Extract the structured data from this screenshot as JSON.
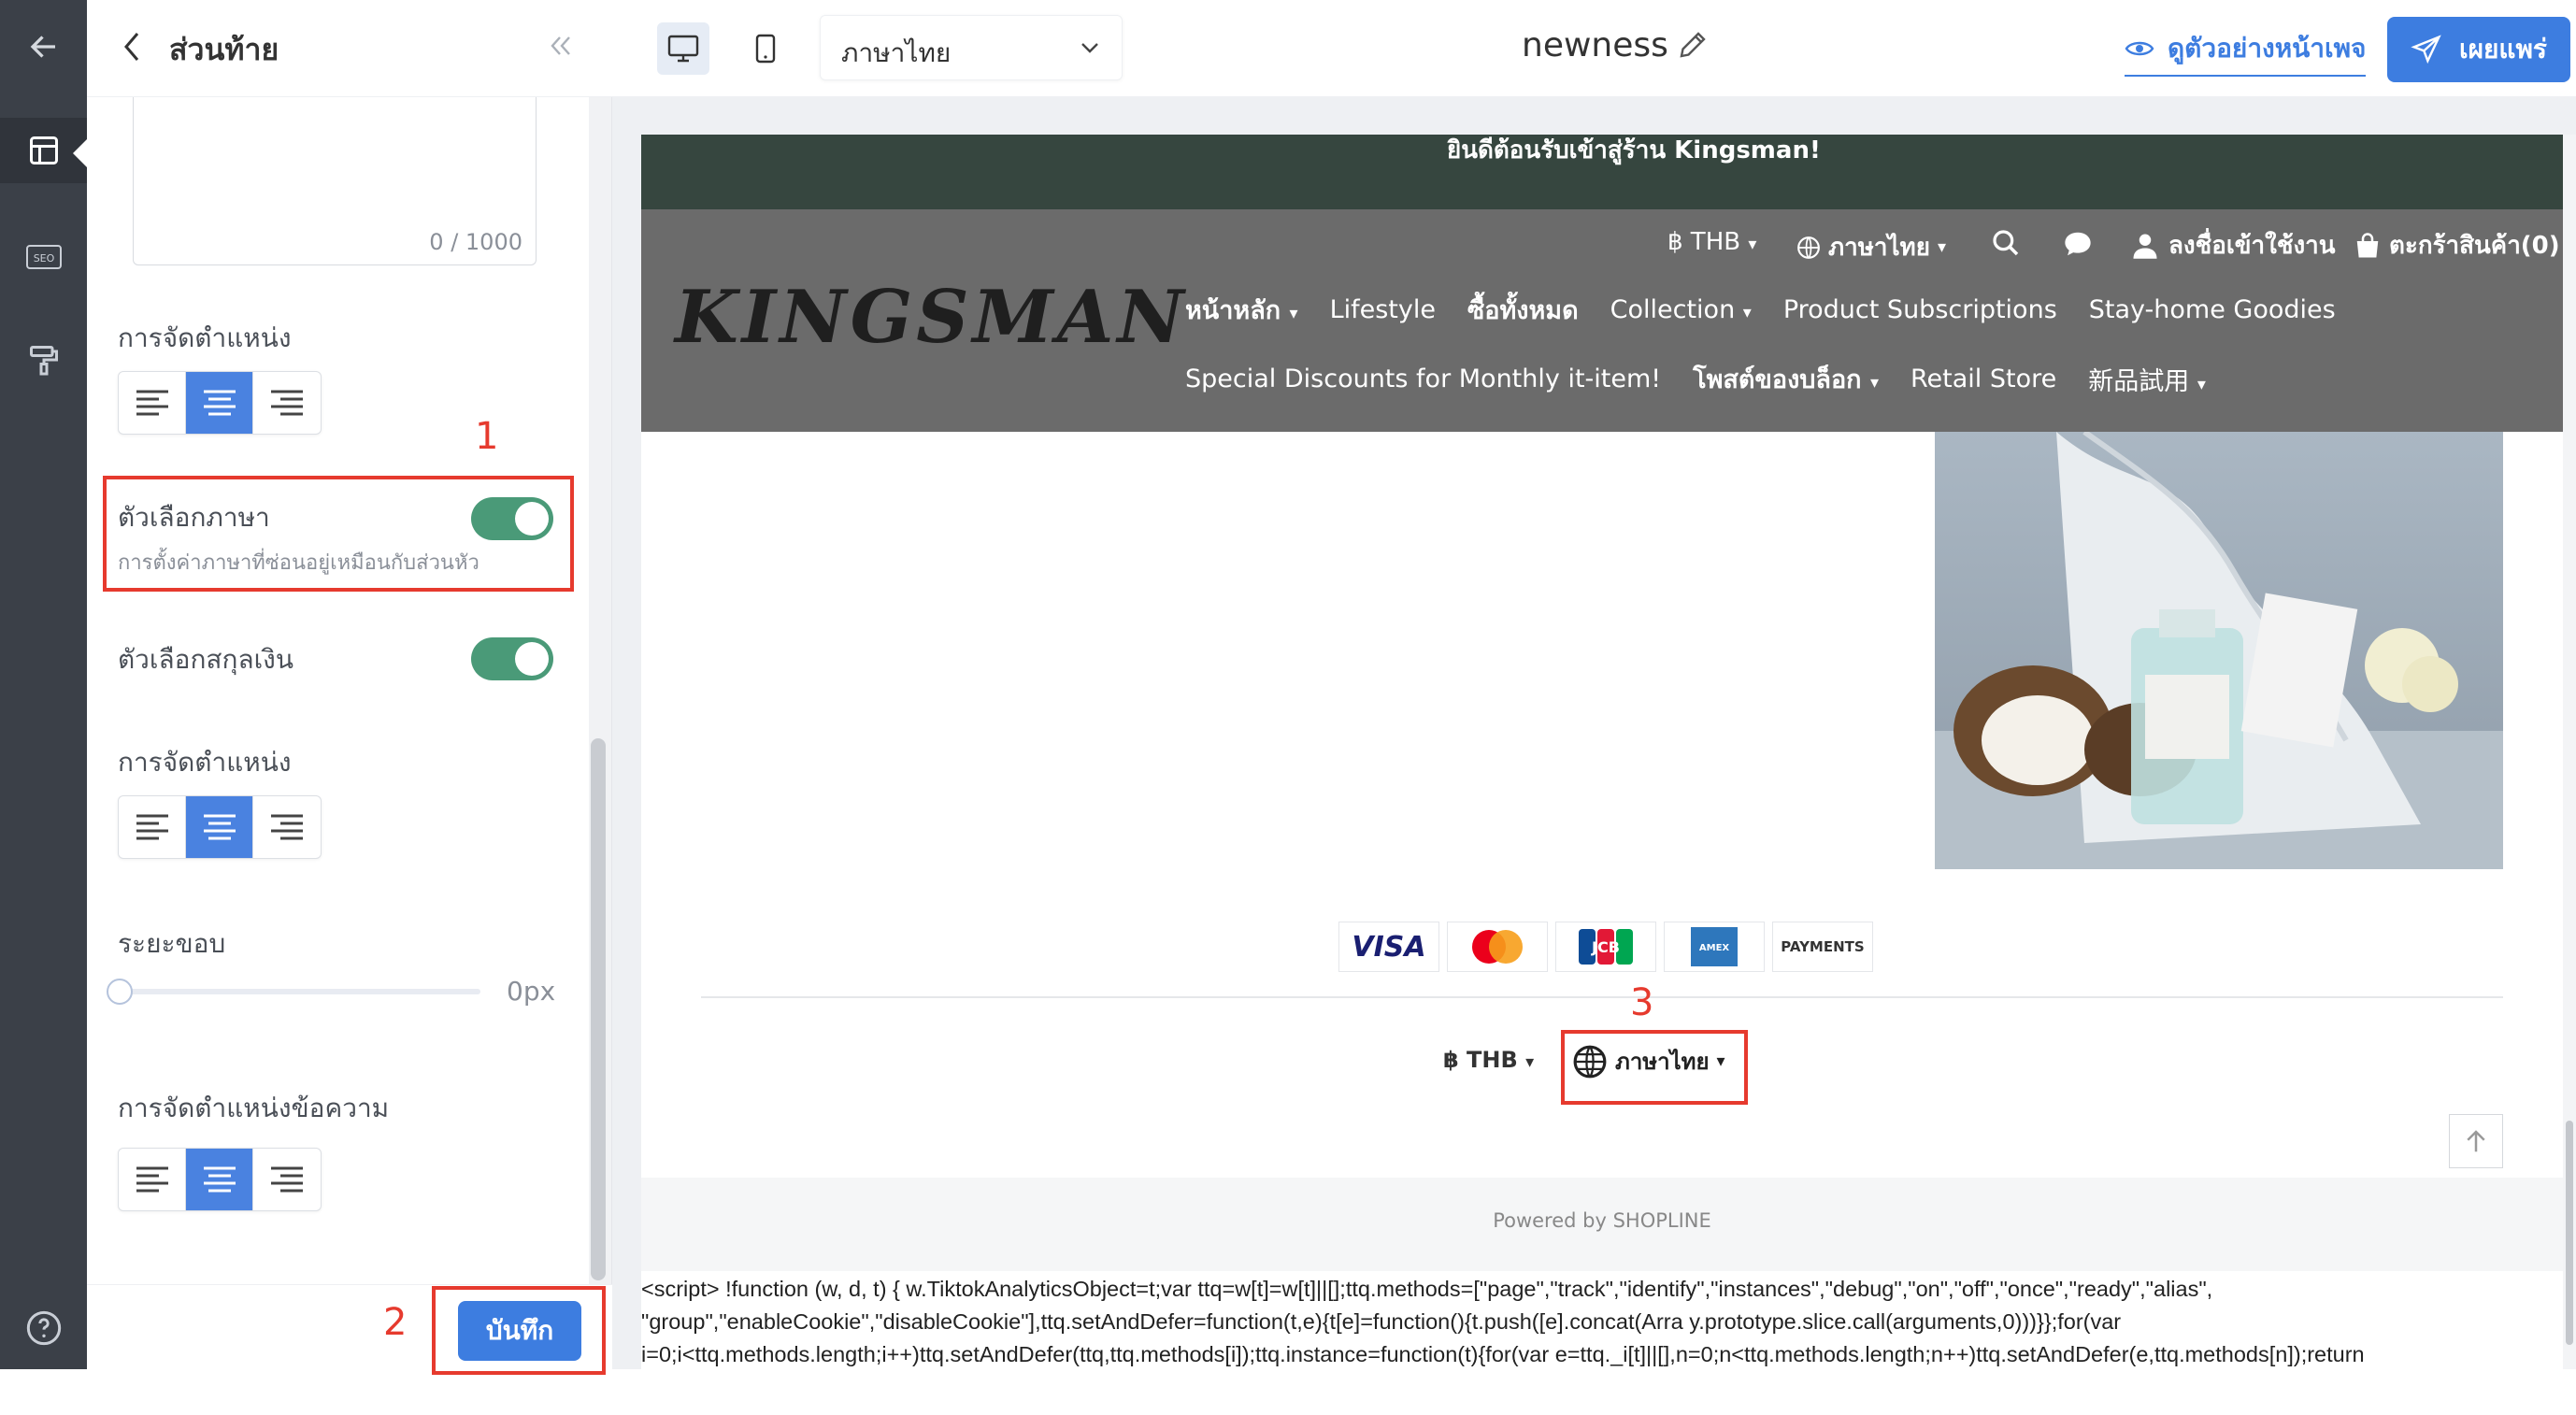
{
  "panel": {
    "title": "ส่วนท้าย",
    "counter": "0 / 1000",
    "alignment_label": "การจัดตำแหน่ง",
    "language_selector": {
      "label": "ตัวเลือกภาษา",
      "hint": "การตั้งค่าภาษาที่ซ่อนอยู่เหมือนกับส่วนหัว",
      "enabled": true
    },
    "currency_selector": {
      "label": "ตัวเลือกสกุลเงิน",
      "enabled": true
    },
    "alignment_label_2": "การจัดตำแหน่ง",
    "margin": {
      "label": "ระยะขอบ",
      "value": "0px"
    },
    "text_alignment_label": "การจัดตำแหน่งข้อความ",
    "save_label": "บันทึก"
  },
  "topbar": {
    "language_select": "ภาษาไทย",
    "page_name": "newness",
    "preview_label": "ดูตัวอย่างหน้าเพจ",
    "publish_label": "เผยแพร่"
  },
  "site": {
    "announcement": "ยินดีต้อนรับเข้าสู่ร้าน Kingsman!",
    "logo": "KINGSMAN",
    "currency": "฿ THB",
    "language": "ภาษาไทย",
    "login": "ลงชื่อเข้าใช้งาน",
    "cart": "ตะกร้าสินค้า(0)",
    "menu_row1": [
      "หน้าหลัก",
      "Lifestyle",
      "ซื้อทั้งหมด",
      "Collection",
      "Product Subscriptions",
      "Stay-home Goodies"
    ],
    "menu_row2": [
      "Special Discounts for Monthly it-item!",
      "โพสต์ของบล็อก",
      "Retail Store",
      "新品試用"
    ],
    "payments": [
      "VISA",
      "mastercard",
      "JCB",
      "AMEX",
      "PAYMENTS"
    ],
    "footer_currency": "฿ THB",
    "footer_language": "ภาษาไทย",
    "powered_by": "Powered by SHOPLINE",
    "script_line1": "<script> !function (w, d, t) { w.TiktokAnalyticsObject=t;var ttq=w[t]=w[t]||[];ttq.methods=[\"page\",\"track\",\"identify\",\"instances\",\"debug\",\"on\",\"off\",\"once\",\"ready\",\"alias\",",
    "script_line2": "\"group\",\"enableCookie\",\"disableCookie\"],ttq.setAndDefer=function(t,e){t[e]=function(){t.push([e].concat(Arra y.prototype.slice.call(arguments,0)))}};for(var",
    "script_line3": "i=0;i<ttq.methods.length;i++)ttq.setAndDefer(ttq,ttq.methods[i]);ttq.instance=function(t){for(var e=ttq._i[t]||[],n=0;n<ttq.methods.length;n++)ttq.setAndDefer(e,ttq.methods[n]);return"
  },
  "annotations": {
    "one": "1",
    "two": "2",
    "three": "3"
  },
  "colors": {
    "accent": "#4a82e0",
    "toggle_on": "#4a9a78",
    "highlight": "#e63a2e",
    "rail": "#3b4048",
    "announcement_bg": "#36463f",
    "header_bg": "#6b6b6b"
  }
}
